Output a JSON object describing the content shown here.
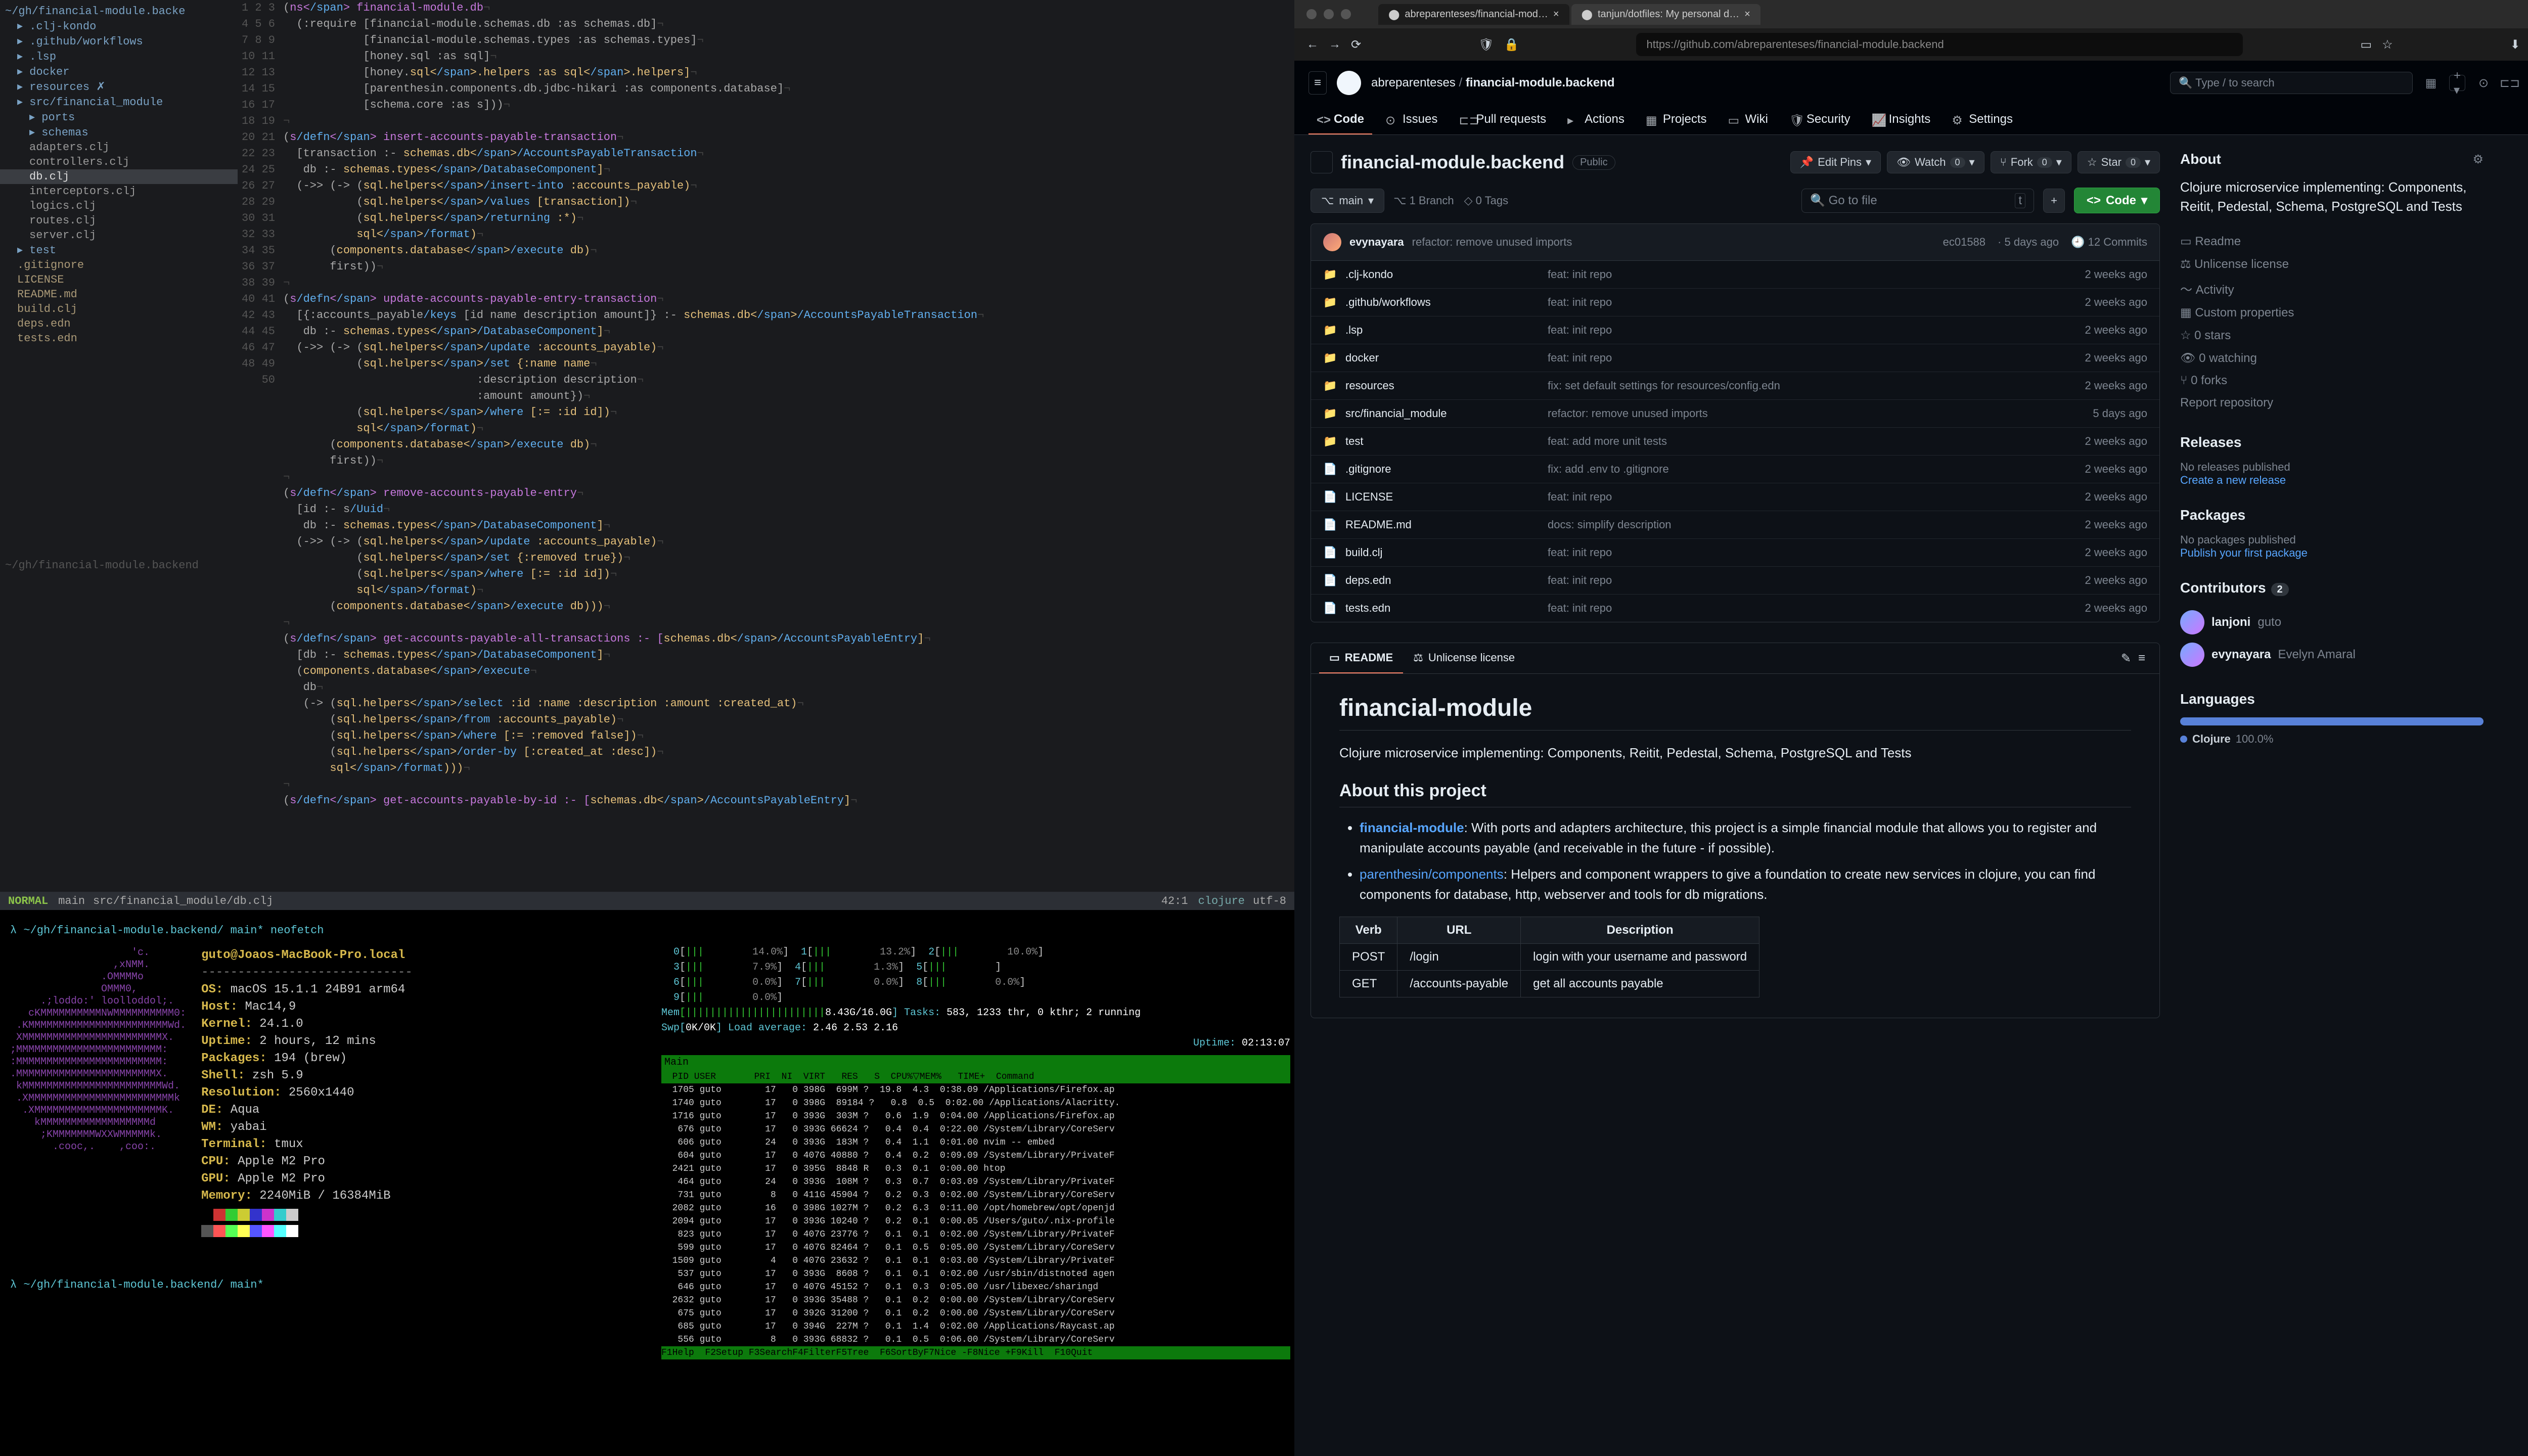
{
  "browser": {
    "tabs": [
      {
        "title": "abreparenteses/financial-mod…",
        "active": true
      },
      {
        "title": "tanjun/dotfiles: My personal d…",
        "active": false
      }
    ],
    "url": "https://github.com/abreparenteses/financial-module.backend"
  },
  "github": {
    "owner": "abreparenteses",
    "repo": "financial-module.backend",
    "visibility": "Public",
    "search_placeholder": "Type / to search",
    "nav": [
      {
        "label": "Code",
        "active": true
      },
      {
        "label": "Issues"
      },
      {
        "label": "Pull requests"
      },
      {
        "label": "Actions"
      },
      {
        "label": "Projects"
      },
      {
        "label": "Wiki"
      },
      {
        "label": "Security"
      },
      {
        "label": "Insights"
      },
      {
        "label": "Settings"
      }
    ],
    "actions": {
      "edit_pins": "Edit Pins",
      "watch": "Watch",
      "watch_count": "0",
      "fork": "Fork",
      "fork_count": "0",
      "star": "Star",
      "star_count": "0"
    },
    "branch": "main",
    "branches": "1 Branch",
    "tags": "0 Tags",
    "file_search_placeholder": "Go to file",
    "code_btn": "Code",
    "last_commit": {
      "author": "evynayara",
      "message": "refactor: remove unused imports",
      "sha": "ec01588",
      "when": "5 days ago",
      "commits": "12 Commits"
    },
    "files": [
      {
        "type": "dir",
        "name": ".clj-kondo",
        "msg": "feat: init repo",
        "when": "2 weeks ago"
      },
      {
        "type": "dir",
        "name": ".github/workflows",
        "msg": "feat: init repo",
        "when": "2 weeks ago"
      },
      {
        "type": "dir",
        "name": ".lsp",
        "msg": "feat: init repo",
        "when": "2 weeks ago"
      },
      {
        "type": "dir",
        "name": "docker",
        "msg": "feat: init repo",
        "when": "2 weeks ago"
      },
      {
        "type": "dir",
        "name": "resources",
        "msg": "fix: set default settings for resources/config.edn",
        "when": "2 weeks ago"
      },
      {
        "type": "dir",
        "name": "src/financial_module",
        "msg": "refactor: remove unused imports",
        "when": "5 days ago"
      },
      {
        "type": "dir",
        "name": "test",
        "msg": "feat: add more unit tests",
        "when": "2 weeks ago"
      },
      {
        "type": "file",
        "name": ".gitignore",
        "msg": "fix: add .env to .gitignore",
        "when": "2 weeks ago"
      },
      {
        "type": "file",
        "name": "LICENSE",
        "msg": "feat: init repo",
        "when": "2 weeks ago"
      },
      {
        "type": "file",
        "name": "README.md",
        "msg": "docs: simplify description",
        "when": "2 weeks ago"
      },
      {
        "type": "file",
        "name": "build.clj",
        "msg": "feat: init repo",
        "when": "2 weeks ago"
      },
      {
        "type": "file",
        "name": "deps.edn",
        "msg": "feat: init repo",
        "when": "2 weeks ago"
      },
      {
        "type": "file",
        "name": "tests.edn",
        "msg": "feat: init repo",
        "when": "2 weeks ago"
      }
    ],
    "readme_tabs": {
      "readme": "README",
      "license": "Unlicense license"
    },
    "readme": {
      "title": "financial-module",
      "intro": "Clojure microservice implementing: Components, Reitit, Pedestal, Schema, PostgreSQL and Tests",
      "section": "About this project",
      "bullet1_strong": "financial-module",
      "bullet1_text": ": With ports and adapters architecture, this project is a simple financial module that allows you to register and manipulate accounts payable (and receivable in the future - if possible).",
      "bullet2_link": "parenthesin/components",
      "bullet2_text": ": Helpers and component wrappers to give a foundation to create new services in clojure, you can find components for database, http, webserver and tools for db migrations.",
      "table": {
        "headers": [
          "Verb",
          "URL",
          "Description"
        ],
        "rows": [
          [
            "POST",
            "/login",
            "login with your username and password"
          ],
          [
            "GET",
            "/accounts-payable",
            "get all accounts payable"
          ]
        ]
      }
    },
    "sidebar": {
      "about": "About",
      "desc": "Clojure microservice implementing: Components, Reitit, Pedestal, Schema, PostgreSQL and Tests",
      "links": [
        "Readme",
        "Unlicense license",
        "Activity",
        "Custom properties"
      ],
      "stats": [
        "0 stars",
        "0 watching",
        "0 forks"
      ],
      "report": "Report repository",
      "releases": "Releases",
      "no_releases": "No releases published",
      "create_release": "Create a new release",
      "packages": "Packages",
      "no_packages": "No packages published",
      "publish_package": "Publish your first package",
      "contributors": "Contributors",
      "contributors_count": "2",
      "people": [
        {
          "name": "lanjoni",
          "full": "guto"
        },
        {
          "name": "evynayara",
          "full": "Evelyn Amaral"
        }
      ],
      "languages": "Languages",
      "lang_name": "Clojure",
      "lang_pct": "100.0%"
    }
  },
  "editor": {
    "path_header": "~/gh/financial-module.backe",
    "tree": [
      {
        "label": ".clj-kondo",
        "type": "dir",
        "depth": 1
      },
      {
        "label": ".github/workflows",
        "type": "dir",
        "depth": 1
      },
      {
        "label": ".lsp",
        "type": "dir",
        "depth": 1
      },
      {
        "label": "docker",
        "type": "dir",
        "depth": 1
      },
      {
        "label": "resources ✗",
        "type": "dir",
        "depth": 1
      },
      {
        "label": "src/financial_module",
        "type": "dir",
        "depth": 1,
        "open": true
      },
      {
        "label": "ports",
        "type": "dir",
        "depth": 2
      },
      {
        "label": "schemas",
        "type": "dir",
        "depth": 2
      },
      {
        "label": "adapters.clj",
        "type": "file",
        "depth": 2
      },
      {
        "label": "controllers.clj",
        "type": "file",
        "depth": 2
      },
      {
        "label": "db.clj",
        "type": "file",
        "depth": 2,
        "sel": true
      },
      {
        "label": "interceptors.clj",
        "type": "file",
        "depth": 2
      },
      {
        "label": "logics.clj",
        "type": "file",
        "depth": 2
      },
      {
        "label": "routes.clj",
        "type": "file",
        "depth": 2
      },
      {
        "label": "server.clj",
        "type": "file",
        "depth": 2
      },
      {
        "label": "test",
        "type": "dir",
        "depth": 1
      },
      {
        "label": ".gitignore",
        "type": "mod",
        "depth": 1
      },
      {
        "label": "LICENSE",
        "type": "mod",
        "depth": 1
      },
      {
        "label": "README.md",
        "type": "mod",
        "depth": 1
      },
      {
        "label": "build.clj",
        "type": "mod",
        "depth": 1
      },
      {
        "label": "deps.edn",
        "type": "mod",
        "depth": 1
      },
      {
        "label": "tests.edn",
        "type": "mod",
        "depth": 1
      }
    ],
    "buffer_note": "~/gh/financial-module.backend",
    "code_lines": [
      "(ns financial-module.db",
      "  (:require [financial-module.schemas.db :as schemas.db]",
      "            [financial-module.schemas.types :as schemas.types]",
      "            [honey.sql :as sql]",
      "            [honey.sql.helpers :as sql.helpers]",
      "            [parenthesin.components.db.jdbc-hikari :as components.database]",
      "            [schema.core :as s]))",
      "",
      "(s/defn insert-accounts-payable-transaction",
      "  [transaction :- schemas.db/AccountsPayableTransaction",
      "   db :- schemas.types/DatabaseComponent]",
      "  (->> (-> (sql.helpers/insert-into :accounts_payable)",
      "           (sql.helpers/values [transaction])",
      "           (sql.helpers/returning :*)",
      "           sql/format)",
      "       (components.database/execute db)",
      "       first))",
      "",
      "(s/defn update-accounts-payable-entry-transaction",
      "  [{:accounts_payable/keys [id name description amount]} :- schemas.db/AccountsPayableTransaction",
      "   db :- schemas.types/DatabaseComponent]",
      "  (->> (-> (sql.helpers/update :accounts_payable)",
      "           (sql.helpers/set {:name name",
      "                             :description description",
      "                             :amount amount})",
      "           (sql.helpers/where [:= :id id])",
      "           sql/format)",
      "       (components.database/execute db)",
      "       first))",
      "",
      "(s/defn remove-accounts-payable-entry",
      "  [id :- s/Uuid",
      "   db :- schemas.types/DatabaseComponent]",
      "  (->> (-> (sql.helpers/update :accounts_payable)",
      "           (sql.helpers/set {:removed true})",
      "           (sql.helpers/where [:= :id id])",
      "           sql/format)",
      "       (components.database/execute db)))",
      "",
      "(s/defn get-accounts-payable-all-transactions :- [schemas.db/AccountsPayableEntry]",
      "  [db :- schemas.types/DatabaseComponent]",
      "  (components.database/execute",
      "   db",
      "   (-> (sql.helpers/select :id :name :description :amount :created_at)",
      "       (sql.helpers/from :accounts_payable)",
      "       (sql.helpers/where [:= :removed false])",
      "       (sql.helpers/order-by [:created_at :desc])",
      "       sql/format)))",
      "",
      "(s/defn get-accounts-payable-by-id :- [schemas.db/AccountsPayableEntry]"
    ],
    "status": {
      "mode": "NORMAL",
      "branch": "main",
      "file": "src/financial_module/db.clj",
      "pos": "42:1",
      "lang": "clojure",
      "enc": "utf-8"
    }
  },
  "terminal": {
    "prompt1": "λ ~/gh/financial-module.backend/ main* neofetch",
    "prompt2": "λ ~/gh/financial-module.backend/ main* ",
    "neofetch": {
      "user_host": "guto@Joaos-MacBook-Pro.local",
      "os": "macOS 15.1.1 24B91 arm64",
      "host": "Mac14,9",
      "kernel": "24.1.0",
      "uptime": "2 hours, 12 mins",
      "packages": "194 (brew)",
      "shell": "zsh 5.9",
      "resolution": "2560x1440",
      "de": "Aqua",
      "wm": "yabai",
      "terminal": "tmux",
      "cpu": "Apple M2 Pro",
      "gpu": "Apple M2 Pro",
      "memory": "2240MiB / 16384MiB"
    },
    "htop": {
      "cpu_bars": [
        {
          "n": "0",
          "pct": "14.0%"
        },
        {
          "n": "1",
          "pct": "13.2%"
        },
        {
          "n": "2",
          "pct": "10.0%"
        },
        {
          "n": "3",
          "pct": "7.9%"
        },
        {
          "n": "4",
          "pct": "1.3%"
        },
        {
          "n": "5",
          "pct": ""
        },
        {
          "n": "6",
          "pct": "0.0%"
        },
        {
          "n": "7",
          "pct": "0.0%"
        },
        {
          "n": "8",
          "pct": "0.0%"
        },
        {
          "n": "9",
          "pct": "0.0%"
        }
      ],
      "mem": "8.43G/16.0G",
      "swp": "0K/0K",
      "tasks": "583, 1233 thr, 0 kthr; 2 running",
      "load": "2.46 2.53 2.16",
      "uptime": "02:13:07",
      "headers": "  PID USER       PRI  NI  VIRT   RES   S  CPU%▽MEM%   TIME+  Command",
      "rows": [
        "  1705 guto        17   0 398G  699M ?  19.8  4.3  0:38.09 /Applications/Firefox.ap",
        "  1740 guto        17   0 398G  89184 ?   0.8  0.5  0:02.00 /Applications/Alacritty.",
        "  1716 guto        17   0 393G  303M ?   0.6  1.9  0:04.00 /Applications/Firefox.ap",
        "   676 guto        17   0 393G 66624 ?   0.4  0.4  0:22.00 /System/Library/CoreServ",
        "   606 guto        24   0 393G  183M ?   0.4  1.1  0:01.00 nvim -- embed",
        "   604 guto        17   0 407G 40880 ?   0.4  0.2  0:09.09 /System/Library/PrivateF",
        "  2421 guto        17   0 395G  8848 R   0.3  0.1  0:00.00 htop",
        "   464 guto        24   0 393G  108M ?   0.3  0.7  0:03.09 /System/Library/PrivateF",
        "   731 guto         8   0 411G 45904 ?   0.2  0.3  0:02.00 /System/Library/CoreServ",
        "  2082 guto        16   0 398G 1027M ?   0.2  6.3  0:11.00 /opt/homebrew/opt/openjd",
        "  2094 guto        17   0 393G 10240 ?   0.2  0.1  0:00.05 /Users/guto/.nix-profile",
        "   823 guto        17   0 407G 23776 ?   0.1  0.1  0:02.00 /System/Library/PrivateF",
        "   599 guto        17   0 407G 82464 ?   0.1  0.5  0:05.00 /System/Library/CoreServ",
        "  1509 guto         4   0 407G 23632 ?   0.1  0.1  0:03.00 /System/Library/PrivateF",
        "   537 guto        17   0 393G  8608 ?   0.1  0.1  0:02.00 /usr/sbin/distnoted agen",
        "   646 guto        17   0 407G 45152 ?   0.1  0.3  0:05.00 /usr/libexec/sharingd",
        "  2632 guto        17   0 393G 35488 ?   0.1  0.2  0:00.00 /System/Library/CoreServ",
        "   675 guto        17   0 392G 31200 ?   0.1  0.2  0:00.00 /System/Library/CoreServ",
        "   685 guto        17   0 394G  227M ?   0.1  1.4  0:02.00 /Applications/Raycast.ap",
        "   556 guto         8   0 393G 68832 ?   0.1  0.5  0:06.00 /System/Library/CoreServ"
      ],
      "fnkeys": "F1Help  F2Setup F3SearchF4FilterF5Tree  F6SortByF7Nice -F8Nice +F9Kill  F10Quit"
    }
  }
}
